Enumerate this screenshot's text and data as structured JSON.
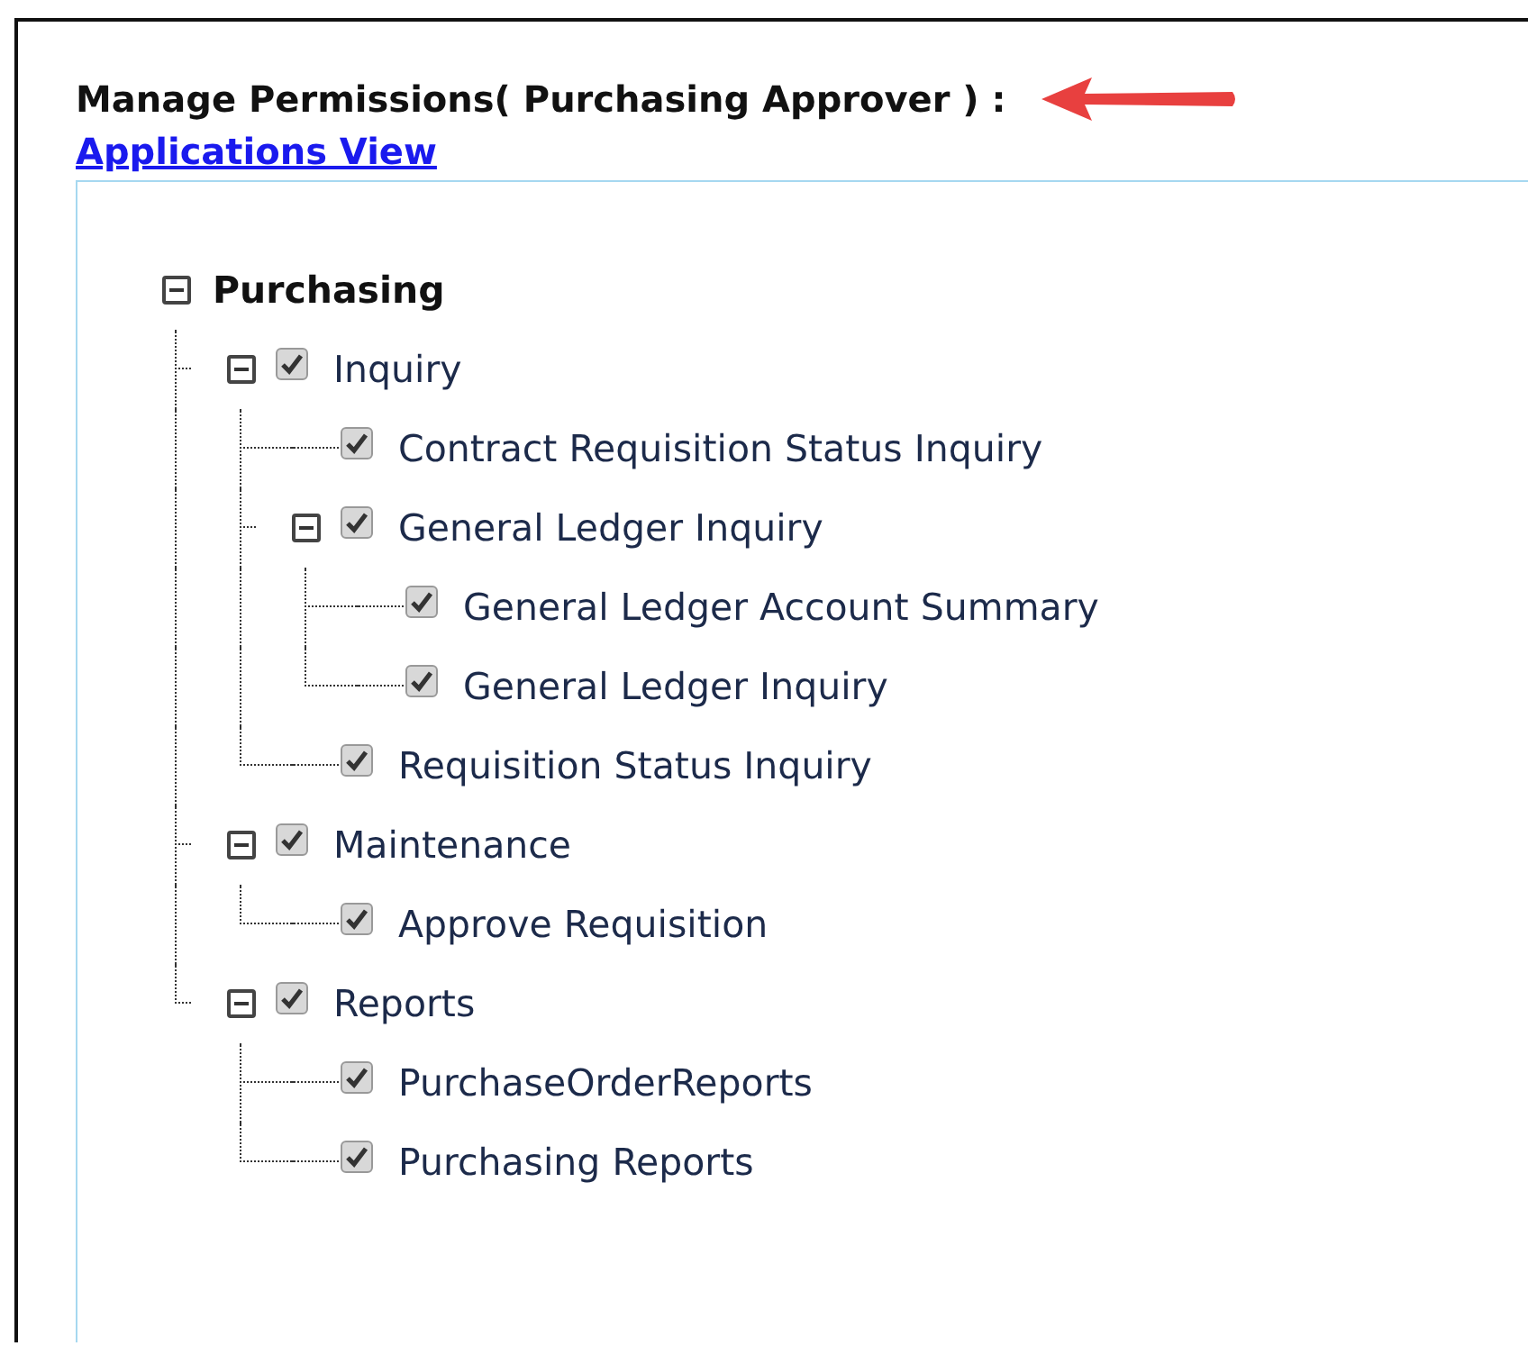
{
  "heading": {
    "title": "Manage Permissions( Purchasing Approver ) :",
    "link": "Applications View"
  },
  "tree": [
    {
      "label": "Purchasing",
      "expanded": true,
      "children": [
        {
          "label": "Inquiry",
          "expanded": true,
          "checked": true,
          "children": [
            {
              "label": "Contract Requisition Status Inquiry",
              "checked": true
            },
            {
              "label": "General Ledger Inquiry",
              "expanded": true,
              "checked": true,
              "children": [
                {
                  "label": "General Ledger Account Summary",
                  "checked": true
                },
                {
                  "label": "General Ledger Inquiry",
                  "checked": true
                }
              ]
            },
            {
              "label": "Requisition Status Inquiry",
              "checked": true
            }
          ]
        },
        {
          "label": "Maintenance",
          "expanded": true,
          "checked": true,
          "children": [
            {
              "label": "Approve Requisition",
              "checked": true
            }
          ]
        },
        {
          "label": "Reports",
          "expanded": true,
          "checked": true,
          "children": [
            {
              "label": "PurchaseOrderReports",
              "checked": true
            },
            {
              "label": "Purchasing Reports",
              "checked": true
            }
          ]
        }
      ]
    }
  ]
}
